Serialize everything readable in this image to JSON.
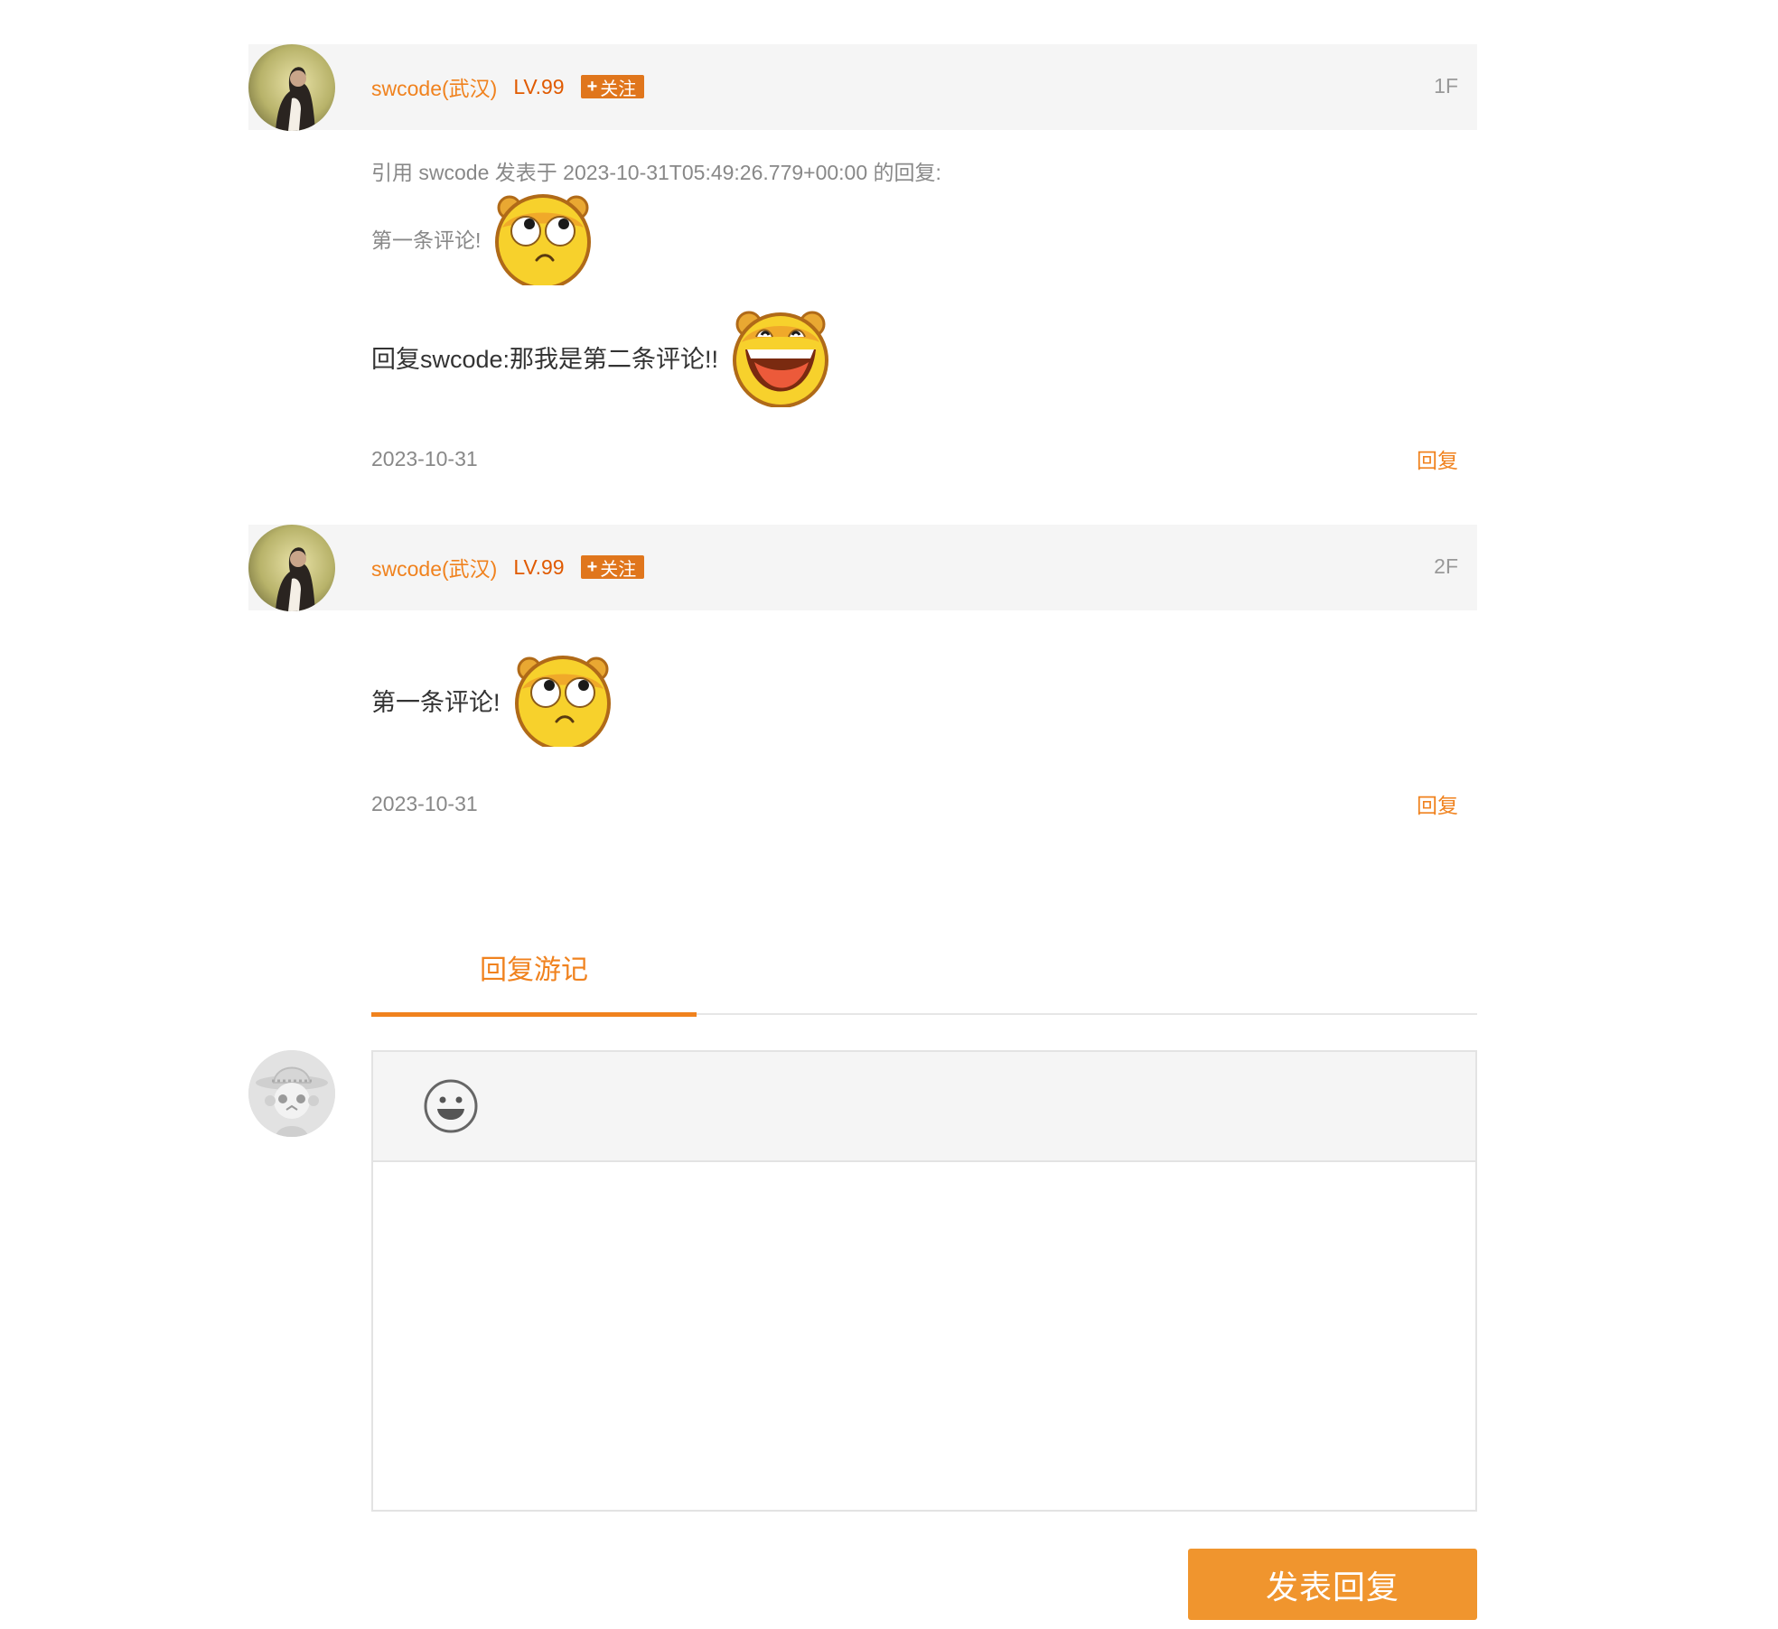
{
  "comments": [
    {
      "username": "swcode(武汉)",
      "level": "LV.99",
      "follow_label": "关注",
      "floor": "1F",
      "quote": {
        "meta": "引用 swcode 发表于 2023-10-31T05:49:26.779+00:00 的回复:",
        "text": "第一条评论!",
        "emoji": "thinking-face-emoji"
      },
      "text": "回复swcode:那我是第二条评论!!",
      "emoji": "laughing-face-emoji",
      "date": "2023-10-31",
      "reply_label": "回复"
    },
    {
      "username": "swcode(武汉)",
      "level": "LV.99",
      "follow_label": "关注",
      "floor": "2F",
      "text": "第一条评论!",
      "emoji": "thinking-face-emoji",
      "date": "2023-10-31",
      "reply_label": "回复"
    }
  ],
  "reply_section": {
    "tab_label": "回复游记",
    "toolbar_icon": "smiley-icon",
    "textarea_value": "",
    "submit_label": "发表回复"
  },
  "colors": {
    "accent": "#f0821e",
    "level": "#e05a00",
    "follow_bg": "#e0761c",
    "submit_bg": "#f0952e",
    "header_bg": "#f5f5f5"
  }
}
